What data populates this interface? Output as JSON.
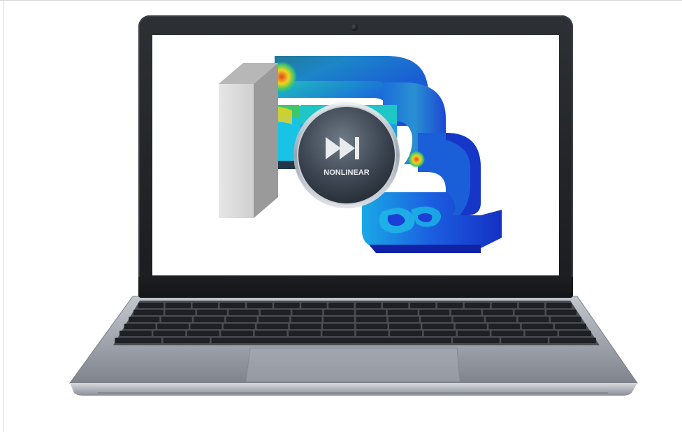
{
  "screen": {
    "badge_label": "NONLINEAR"
  },
  "icons": {
    "badge_icon": "fast-forward-icon"
  },
  "colors": {
    "background": "#ffffff",
    "laptop_body": "#1e2023",
    "deck_silver": "#a9abb3",
    "fea_blue": "#1b3fd6",
    "fea_cyan": "#19c3e6",
    "fea_green": "#3ec86a",
    "fea_yellow": "#f3d21f",
    "fea_red": "#e0432b"
  }
}
